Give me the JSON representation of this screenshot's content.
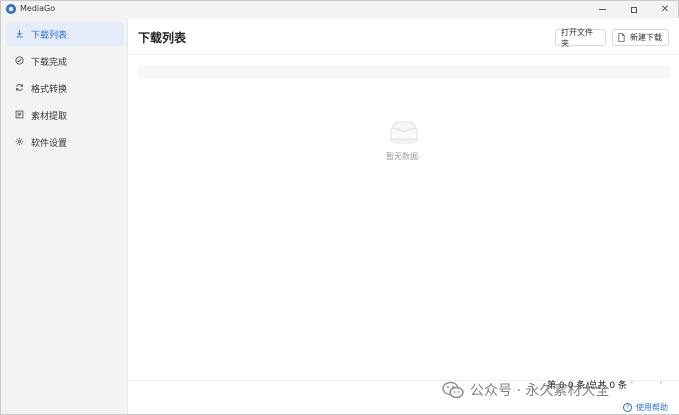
{
  "window": {
    "title": "MediaGo"
  },
  "sidebar": {
    "items": [
      {
        "label": "下载列表",
        "icon": "download-icon",
        "active": true
      },
      {
        "label": "下载完成",
        "icon": "check-circle-icon",
        "active": false
      },
      {
        "label": "格式转换",
        "icon": "refresh-icon",
        "active": false
      },
      {
        "label": "素材提取",
        "icon": "extract-icon",
        "active": false
      },
      {
        "label": "软件设置",
        "icon": "gear-icon",
        "active": false
      }
    ]
  },
  "main": {
    "title": "下载列表",
    "open_folder_label": "打开文件夹",
    "new_download_label": "新建下载",
    "empty_text": "暂无数据"
  },
  "pagination": {
    "summary": "第 0-0 条/总共 0 条",
    "prev": "‹",
    "next": "›"
  },
  "help": {
    "label": "使用帮助"
  },
  "watermark": {
    "text": "公众号 · 永久素材大全"
  },
  "colors": {
    "accent": "#2d6fd6",
    "active_bg": "#e3ecf8"
  }
}
